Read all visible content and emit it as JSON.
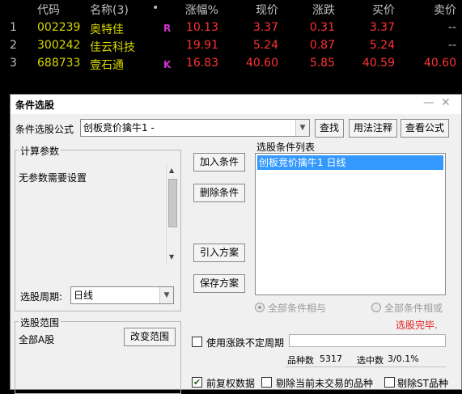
{
  "quote_table": {
    "headers": {
      "code": "代码",
      "name": "名称(3)",
      "dot": "•",
      "change_pct": "涨幅%",
      "price": "现价",
      "change": "涨跌",
      "bid": "买价",
      "ask": "卖价"
    },
    "rows": [
      {
        "idx": "1",
        "code": "002239",
        "name": "奥特佳",
        "flag": "R",
        "change_pct": "10.13",
        "price": "3.37",
        "change": "0.31",
        "bid": "3.37",
        "ask": "--"
      },
      {
        "idx": "2",
        "code": "300242",
        "name": "佳云科技",
        "flag": "",
        "change_pct": "19.91",
        "price": "5.24",
        "change": "0.87",
        "bid": "5.24",
        "ask": "--"
      },
      {
        "idx": "3",
        "code": "688733",
        "name": "壹石通",
        "flag": "K",
        "change_pct": "16.83",
        "price": "40.60",
        "change": "5.85",
        "bid": "40.59",
        "ask": "40.60"
      }
    ]
  },
  "dialog": {
    "title": "条件选股",
    "formula_label": "条件选股公式",
    "formula_value": "创板竞价擒牛1 -",
    "buttons": {
      "search": "查找",
      "usage": "用法注释",
      "view": "查看公式",
      "add": "加入条件",
      "delete": "删除条件",
      "import": "引入方案",
      "save": "保存方案",
      "change_range": "改变范围"
    },
    "params_group": {
      "title": "计算参数",
      "text": "无参数需要设置"
    },
    "period": {
      "label": "选股周期:",
      "value": "日线"
    },
    "cond_list": {
      "title": "选股条件列表",
      "items": [
        "创板竞价擒牛1   日线"
      ]
    },
    "radio_all_and": "全部条件相与",
    "radio_all_or": "全部条件相或",
    "status_done": "选股完毕.",
    "range_group": {
      "title": "选股范围",
      "text": "全部A股"
    },
    "use_uncertain_period": "使用涨跌不定周期",
    "count_label": "品种数",
    "count_value": "5317",
    "selected_label": "选中数",
    "selected_value": "3/0.1%",
    "checks": {
      "pre_adjust": "前复权数据",
      "exclude_untraded": "剔除当前未交易的品种",
      "exclude_st": "剔除ST品种"
    }
  },
  "colors": {
    "bg": "#000000",
    "code": "#d7d700",
    "up": "#ff3232",
    "selection": "#3399ff",
    "status": "#e02020"
  }
}
